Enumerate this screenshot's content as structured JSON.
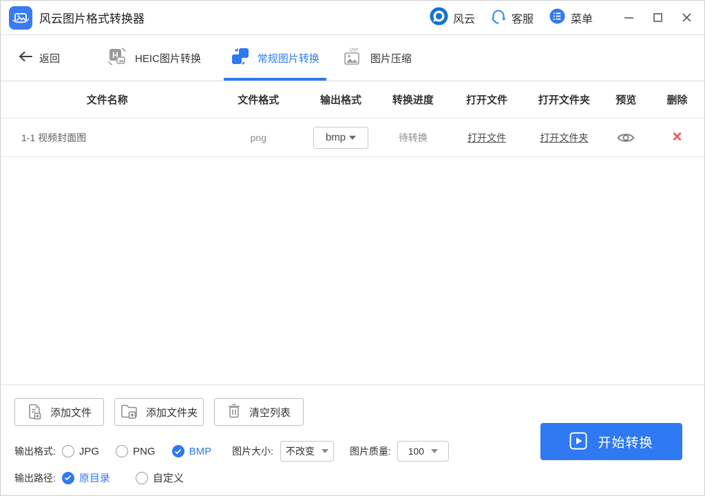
{
  "window": {
    "title": "风云图片格式转换器"
  },
  "titlebar": {
    "brand_label": "风云",
    "support_label": "客服",
    "menu_label": "菜单"
  },
  "nav": {
    "back_label": "返回",
    "tabs": [
      {
        "label": "HEIC图片转换",
        "active": false
      },
      {
        "label": "常规图片转换",
        "active": true
      },
      {
        "label": "图片压缩",
        "active": false
      }
    ],
    "active_tab": "常规图片转换"
  },
  "table": {
    "headers": [
      "文件名称",
      "文件格式",
      "输出格式",
      "转换进度",
      "打开文件",
      "打开文件夹",
      "预览",
      "删除"
    ],
    "rows": [
      {
        "name": "1-1 视频封面图",
        "format": "png",
        "output_format": "bmp",
        "status": "待转换",
        "open_file_label": "打开文件",
        "open_folder_label": "打开文件夹"
      }
    ]
  },
  "actions": {
    "add_file": "添加文件",
    "add_folder": "添加文件夹",
    "clear_list": "清空列表",
    "start": "开始转换"
  },
  "settings": {
    "format_label": "输出格式:",
    "format_options": [
      {
        "label": "JPG",
        "checked": false
      },
      {
        "label": "PNG",
        "checked": false
      },
      {
        "label": "BMP",
        "checked": true
      }
    ],
    "size_label": "图片大小:",
    "size_value": "不改变",
    "quality_label": "图片质量:",
    "quality_value": "100",
    "path_label": "输出路径:",
    "path_options": [
      {
        "label": "原目录",
        "checked": true
      },
      {
        "label": "自定义",
        "checked": false
      }
    ]
  },
  "colors": {
    "accent": "#2f79f2",
    "danger": "#f3524f",
    "text_dark": "#333333",
    "text_muted": "#8c8c8c"
  },
  "icons": {
    "app-icon": "photo-swoosh",
    "brand-icon": "ring-dot",
    "support-icon": "headset",
    "menu-icon": "list-circle",
    "minimize-icon": "—",
    "maximize-icon": "□",
    "close-icon": "✕",
    "back-icon": "←",
    "tab-heic-icon": "h-image-convert",
    "tab-normal-icon": "swap-squares",
    "tab-compress-icon": "zip-image",
    "output-dropdown-icon": "▼",
    "preview-icon": "eye",
    "delete-icon": "✕",
    "add-file-icon": "document-plus",
    "add-folder-icon": "folder-plus",
    "clear-list-icon": "trash",
    "start-icon": "play-square",
    "select-caret-icon": "▼",
    "radio-check-icon": "✓"
  }
}
